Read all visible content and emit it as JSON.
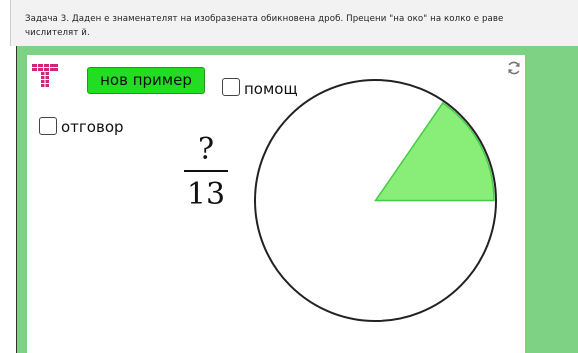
{
  "task": {
    "text": "Задача 3. Даден е знаменателят на изобразената обикновена дроб. Прецени \"на око\" на колко е раве\nчислителят й."
  },
  "toolbar": {
    "new_example_label": "нов пример",
    "help_label": "помощ",
    "answer_label": "отговор"
  },
  "fraction": {
    "numerator": "?",
    "denominator": "13"
  },
  "pie": {
    "total_parts": 13,
    "shaded_parts": 2
  },
  "colors": {
    "accent_green": "#22dd22",
    "panel_green": "#7dd383",
    "sector_fill": "#88ee77",
    "sector_stroke": "#44cc44"
  },
  "icons": {
    "logo": "logo-icon",
    "refresh": "refresh-icon"
  }
}
